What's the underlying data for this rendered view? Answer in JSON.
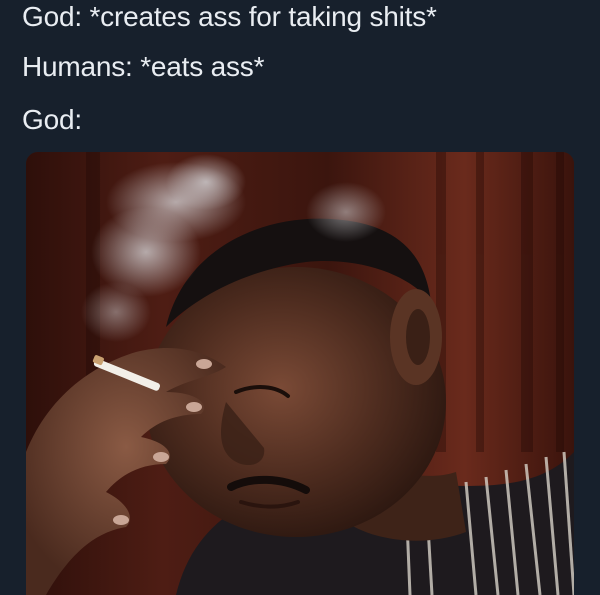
{
  "caption": {
    "line1": "God: *creates ass for taking shits*",
    "line2": "Humans: *eats ass*",
    "line3": "God:"
  },
  "photo": {
    "subject": "man-smoking-cigarette-hand-on-forehead",
    "colors": {
      "background_curtain": "#5a2418",
      "curtain_dark": "#2e0f0a",
      "skin": "#4a2a1e",
      "skin_highlight": "#7a4a36",
      "hair": "#151010",
      "smoke": "#c9c9cc",
      "shirt_dark": "#1e1a1e",
      "shirt_light": "#d8d2c8"
    }
  }
}
